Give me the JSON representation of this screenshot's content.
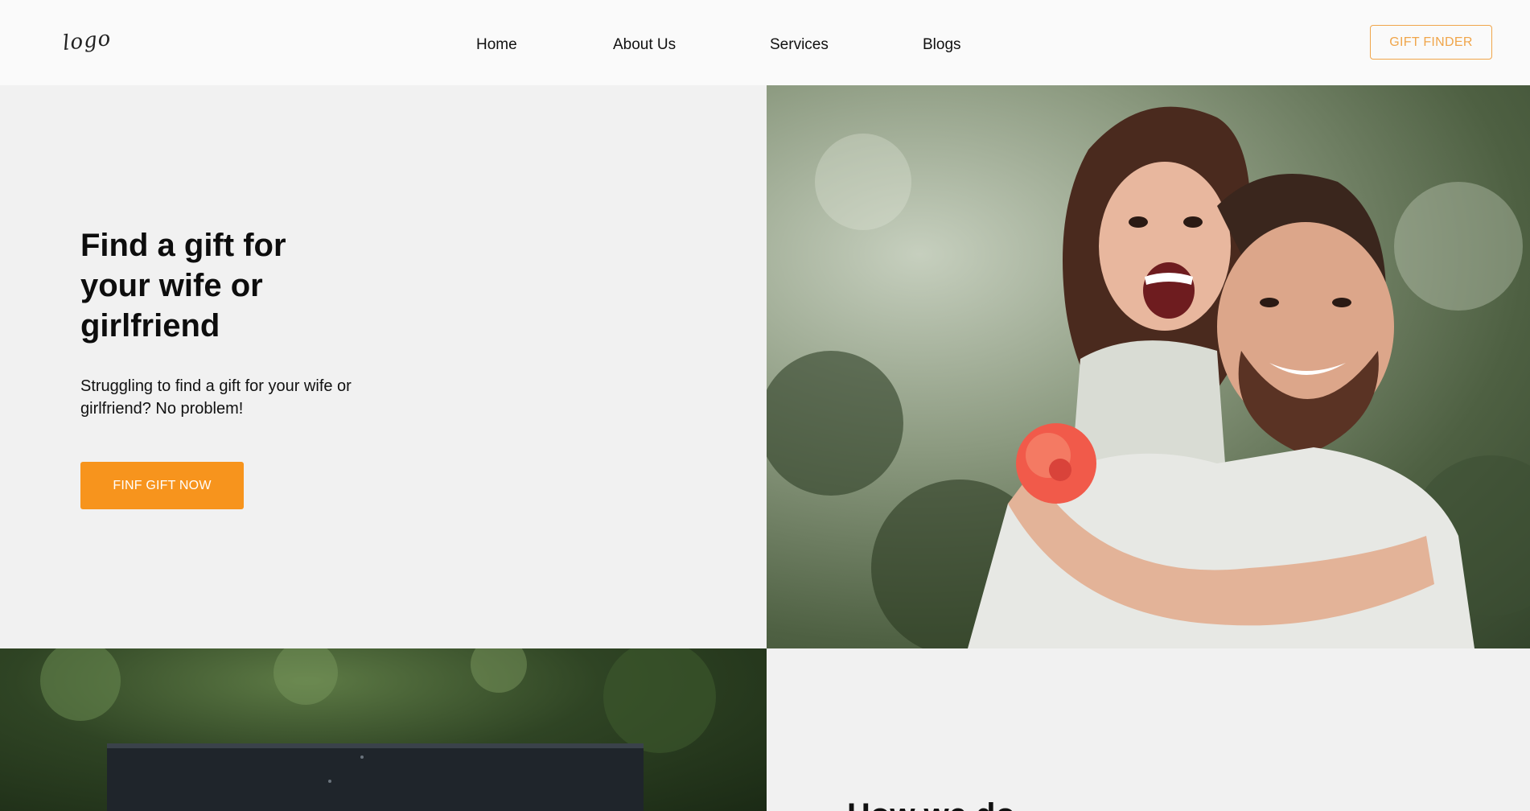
{
  "header": {
    "logo_text": "logo",
    "nav": [
      "Home",
      "About Us",
      "Services",
      "Blogs"
    ],
    "gift_finder_label": "GIFT FINDER"
  },
  "hero": {
    "title": "Find a gift for your wife or girlfriend",
    "subtitle": "Struggling to find a gift for your wife or girlfriend? No problem!",
    "cta_label": "FINF GIFT NOW",
    "cta_color": "#f7941d",
    "photo_icon": "couple-photo"
  },
  "lower": {
    "photo_icon": "gift-box-photo",
    "heading_partial": "How we do"
  },
  "colors": {
    "accent": "#f7941d",
    "outline_accent": "#f0a54a",
    "background": "#f1f1f1"
  }
}
